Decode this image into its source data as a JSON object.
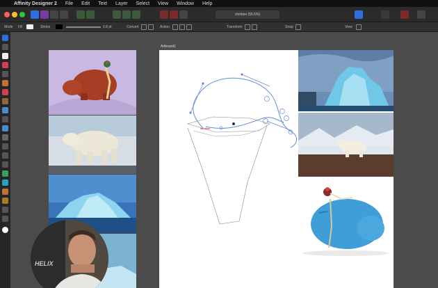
{
  "menubar": {
    "app_name": "Affinity Designer 2",
    "items": [
      "File",
      "Edit",
      "Text",
      "Layer",
      "Select",
      "View",
      "Window",
      "Help"
    ]
  },
  "toolbar": {
    "document_title": "clonbes (55.6%)"
  },
  "context_toolbar": {
    "mode_label": "Mode",
    "fill_label": "Fill",
    "stroke_label": "Stroke",
    "stroke_width": "0.8 pt",
    "convert_label": "Convert",
    "action_label": "Action",
    "transform_label": "Transform",
    "snap_label": "Snap",
    "view_label": "View"
  },
  "canvas": {
    "artboard_label": "Artboard1"
  },
  "webcam": {
    "shirt_text": "HELIX"
  },
  "colors": {
    "accent": "#2f6fe0",
    "canvas_bg": "#4b4b4b",
    "toolbar_bg": "#2b2b2b"
  },
  "icons": [
    "apple-icon",
    "snap-icon",
    "selection-icon",
    "node-icon",
    "pen-icon",
    "pencil-icon",
    "brush-icon",
    "fill-icon",
    "text-icon",
    "zoom-icon"
  ]
}
